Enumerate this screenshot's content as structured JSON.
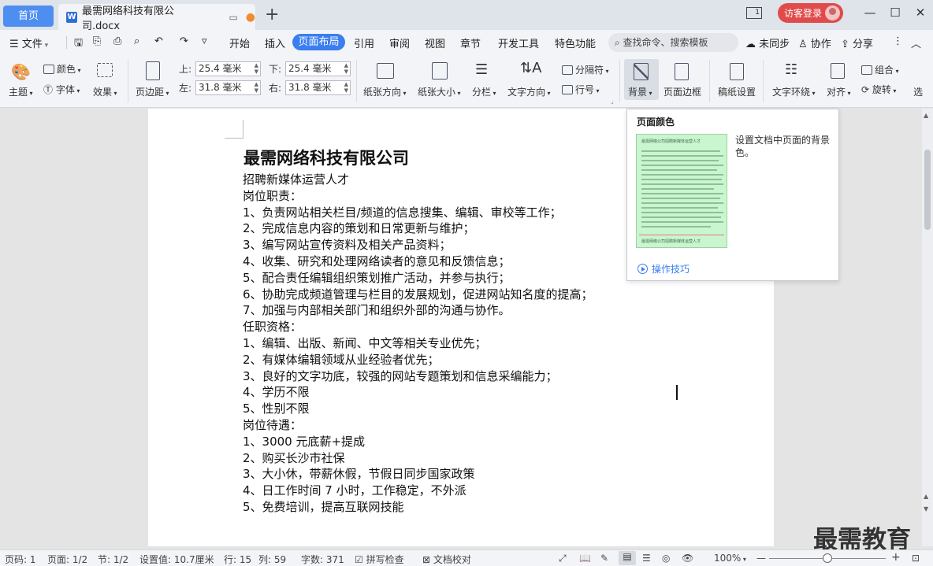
{
  "tabs": {
    "home": "首页",
    "doc_badge": "W",
    "doc_title": "最需网络科技有限公司.docx"
  },
  "titlebar": {
    "pager": "1",
    "login": "访客登录",
    "minimize": "—",
    "maximize": "☐",
    "close": "✕"
  },
  "menu": {
    "file": "文件",
    "items": [
      "开始",
      "插入",
      "页面布局",
      "引用",
      "审阅",
      "视图",
      "章节",
      "开发工具",
      "特色功能"
    ],
    "active": "页面布局",
    "search": "查找命令、搜索模板",
    "sync": "未同步",
    "collab": "协作",
    "share": "分享"
  },
  "ribbon": {
    "theme": "主题",
    "color": "颜色",
    "font": "字体",
    "effect": "效果",
    "margins": "页边距",
    "top_label": "上:",
    "bottom_label": "下:",
    "left_label": "左:",
    "right_label": "右:",
    "top_value": "25.4 毫米",
    "bottom_value": "25.4 毫米",
    "left_value": "31.8 毫米",
    "right_value": "31.8 毫米",
    "orientation": "纸张方向",
    "size": "纸张大小",
    "columns": "分栏",
    "text_direction": "文字方向",
    "separator": "分隔符",
    "line_number": "行号",
    "background": "背景",
    "page_border": "页面边框",
    "manuscript": "稿纸设置",
    "text_wrap": "文字环绕",
    "align": "对齐",
    "group": "组合",
    "rotate": "旋转",
    "select": "选"
  },
  "document": {
    "title": "最需网络科技有限公司",
    "lines": [
      "招聘新媒体运营人才",
      "岗位职责：",
      "1、负责网站相关栏目/频道的信息搜集、编辑、审校等工作；",
      "2、完成信息内容的策划和日常更新与维护；",
      "3、编写网站宣传资料及相关产品资料；",
      "4、收集、研究和处理网络读者的意见和反馈信息；",
      "5、配合责任编辑组织策划推广活动，并参与执行；",
      "6、协助完成频道管理与栏目的发展规划，促进网站知名度的提高；",
      "7、加强与内部相关部门和组织外部的沟通与协作。",
      "任职资格：",
      "1、编辑、出版、新闻、中文等相关专业优先；",
      "2、有媒体编辑领域从业经验者优先；",
      "3、良好的文字功底，较强的网站专题策划和信息采编能力；",
      "4、学历不限",
      "5、性别不限",
      "岗位待遇：",
      "1、3000 元底薪+提成",
      "2、购买长沙市社保",
      "3、大小休，带薪休假，节假日同步国家政策",
      "4、日工作时间 7 小时，工作稳定，不外派",
      "5、免费培训，提高互联网技能"
    ]
  },
  "popup": {
    "title": "页面颜色",
    "thumb_caption": "最需网络公司招聘新媒体运营人才",
    "description": "设置文档中页面的背景色。",
    "link": "操作技巧"
  },
  "status": {
    "page_code": "页码: 1",
    "pages": "页面: 1/2",
    "section": "节: 1/2",
    "setting": "设置值: 10.7厘米",
    "row": "行: 15",
    "col": "列: 59",
    "words": "字数: 371",
    "spell": "拼写检查",
    "proof": "文档校对",
    "zoom": "100%",
    "zoom_minus": "—",
    "zoom_plus": "+",
    "zoom_level": 0.5
  },
  "watermark": "最需教育"
}
